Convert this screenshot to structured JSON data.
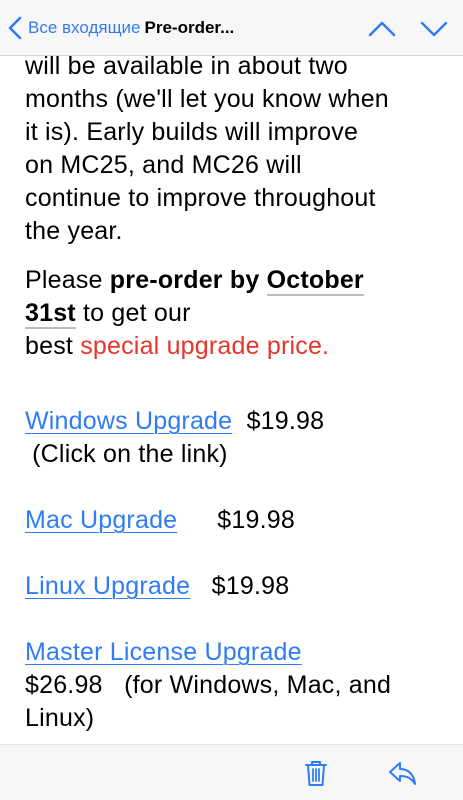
{
  "navbar": {
    "back_label": "Все входящие",
    "title": "Pre-order..."
  },
  "message": {
    "intro_lines": [
      "will be available in about two",
      "months (we'll let you know when",
      "it is).  Early builds will improve",
      "on MC25, and MC26 will",
      "continue to improve throughout",
      "the year."
    ],
    "preorder": {
      "text1": "Please ",
      "bold1": "pre-order by ",
      "bold2": "October",
      "bold3": "31st",
      "text2": " to get our",
      "text3": "best ",
      "red": "special upgrade price."
    },
    "offers": [
      {
        "link": "Windows Upgrade",
        "price": "$19.98",
        "note": "(Click on the link)"
      },
      {
        "link": "Mac Upgrade",
        "price": "$19.98"
      },
      {
        "link": "Linux Upgrade",
        "price": "$19.98"
      },
      {
        "link": "Master License Upgrade",
        "price": "$26.98",
        "note": "(for Windows, Mac, and",
        "note2": "Linux)"
      }
    ]
  },
  "colors": {
    "accent": "#2f7cf6",
    "highlight_red": "#e8342a"
  },
  "icons": [
    "chevron-left-icon",
    "chevron-up-icon",
    "chevron-down-icon",
    "trash-icon",
    "reply-icon"
  ]
}
